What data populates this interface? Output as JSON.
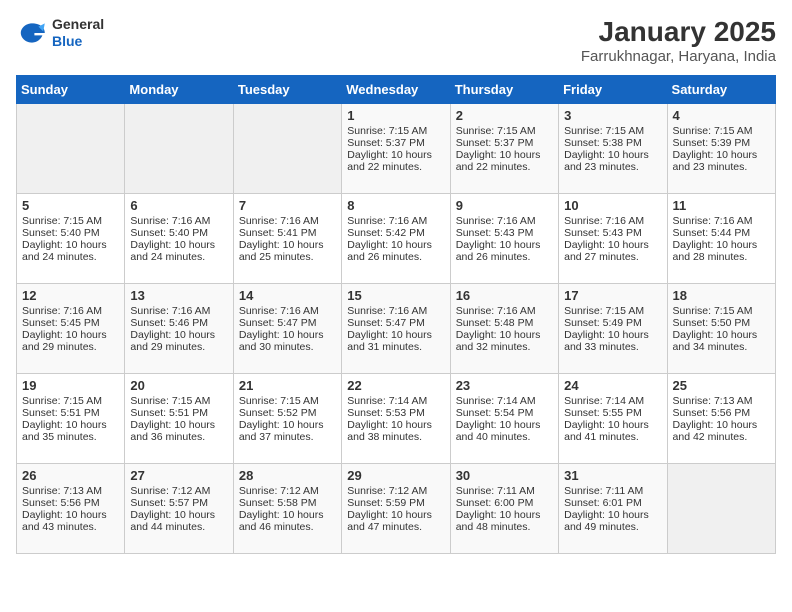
{
  "header": {
    "logo_general": "General",
    "logo_blue": "Blue",
    "title": "January 2025",
    "subtitle": "Farrukhnagar, Haryana, India"
  },
  "weekdays": [
    "Sunday",
    "Monday",
    "Tuesday",
    "Wednesday",
    "Thursday",
    "Friday",
    "Saturday"
  ],
  "weeks": [
    [
      {
        "day": "",
        "info": ""
      },
      {
        "day": "",
        "info": ""
      },
      {
        "day": "",
        "info": ""
      },
      {
        "day": "1",
        "info": "Sunrise: 7:15 AM\nSunset: 5:37 PM\nDaylight: 10 hours\nand 22 minutes."
      },
      {
        "day": "2",
        "info": "Sunrise: 7:15 AM\nSunset: 5:37 PM\nDaylight: 10 hours\nand 22 minutes."
      },
      {
        "day": "3",
        "info": "Sunrise: 7:15 AM\nSunset: 5:38 PM\nDaylight: 10 hours\nand 23 minutes."
      },
      {
        "day": "4",
        "info": "Sunrise: 7:15 AM\nSunset: 5:39 PM\nDaylight: 10 hours\nand 23 minutes."
      }
    ],
    [
      {
        "day": "5",
        "info": "Sunrise: 7:15 AM\nSunset: 5:40 PM\nDaylight: 10 hours\nand 24 minutes."
      },
      {
        "day": "6",
        "info": "Sunrise: 7:16 AM\nSunset: 5:40 PM\nDaylight: 10 hours\nand 24 minutes."
      },
      {
        "day": "7",
        "info": "Sunrise: 7:16 AM\nSunset: 5:41 PM\nDaylight: 10 hours\nand 25 minutes."
      },
      {
        "day": "8",
        "info": "Sunrise: 7:16 AM\nSunset: 5:42 PM\nDaylight: 10 hours\nand 26 minutes."
      },
      {
        "day": "9",
        "info": "Sunrise: 7:16 AM\nSunset: 5:43 PM\nDaylight: 10 hours\nand 26 minutes."
      },
      {
        "day": "10",
        "info": "Sunrise: 7:16 AM\nSunset: 5:43 PM\nDaylight: 10 hours\nand 27 minutes."
      },
      {
        "day": "11",
        "info": "Sunrise: 7:16 AM\nSunset: 5:44 PM\nDaylight: 10 hours\nand 28 minutes."
      }
    ],
    [
      {
        "day": "12",
        "info": "Sunrise: 7:16 AM\nSunset: 5:45 PM\nDaylight: 10 hours\nand 29 minutes."
      },
      {
        "day": "13",
        "info": "Sunrise: 7:16 AM\nSunset: 5:46 PM\nDaylight: 10 hours\nand 29 minutes."
      },
      {
        "day": "14",
        "info": "Sunrise: 7:16 AM\nSunset: 5:47 PM\nDaylight: 10 hours\nand 30 minutes."
      },
      {
        "day": "15",
        "info": "Sunrise: 7:16 AM\nSunset: 5:47 PM\nDaylight: 10 hours\nand 31 minutes."
      },
      {
        "day": "16",
        "info": "Sunrise: 7:16 AM\nSunset: 5:48 PM\nDaylight: 10 hours\nand 32 minutes."
      },
      {
        "day": "17",
        "info": "Sunrise: 7:15 AM\nSunset: 5:49 PM\nDaylight: 10 hours\nand 33 minutes."
      },
      {
        "day": "18",
        "info": "Sunrise: 7:15 AM\nSunset: 5:50 PM\nDaylight: 10 hours\nand 34 minutes."
      }
    ],
    [
      {
        "day": "19",
        "info": "Sunrise: 7:15 AM\nSunset: 5:51 PM\nDaylight: 10 hours\nand 35 minutes."
      },
      {
        "day": "20",
        "info": "Sunrise: 7:15 AM\nSunset: 5:51 PM\nDaylight: 10 hours\nand 36 minutes."
      },
      {
        "day": "21",
        "info": "Sunrise: 7:15 AM\nSunset: 5:52 PM\nDaylight: 10 hours\nand 37 minutes."
      },
      {
        "day": "22",
        "info": "Sunrise: 7:14 AM\nSunset: 5:53 PM\nDaylight: 10 hours\nand 38 minutes."
      },
      {
        "day": "23",
        "info": "Sunrise: 7:14 AM\nSunset: 5:54 PM\nDaylight: 10 hours\nand 40 minutes."
      },
      {
        "day": "24",
        "info": "Sunrise: 7:14 AM\nSunset: 5:55 PM\nDaylight: 10 hours\nand 41 minutes."
      },
      {
        "day": "25",
        "info": "Sunrise: 7:13 AM\nSunset: 5:56 PM\nDaylight: 10 hours\nand 42 minutes."
      }
    ],
    [
      {
        "day": "26",
        "info": "Sunrise: 7:13 AM\nSunset: 5:56 PM\nDaylight: 10 hours\nand 43 minutes."
      },
      {
        "day": "27",
        "info": "Sunrise: 7:12 AM\nSunset: 5:57 PM\nDaylight: 10 hours\nand 44 minutes."
      },
      {
        "day": "28",
        "info": "Sunrise: 7:12 AM\nSunset: 5:58 PM\nDaylight: 10 hours\nand 46 minutes."
      },
      {
        "day": "29",
        "info": "Sunrise: 7:12 AM\nSunset: 5:59 PM\nDaylight: 10 hours\nand 47 minutes."
      },
      {
        "day": "30",
        "info": "Sunrise: 7:11 AM\nSunset: 6:00 PM\nDaylight: 10 hours\nand 48 minutes."
      },
      {
        "day": "31",
        "info": "Sunrise: 7:11 AM\nSunset: 6:01 PM\nDaylight: 10 hours\nand 49 minutes."
      },
      {
        "day": "",
        "info": ""
      }
    ]
  ]
}
